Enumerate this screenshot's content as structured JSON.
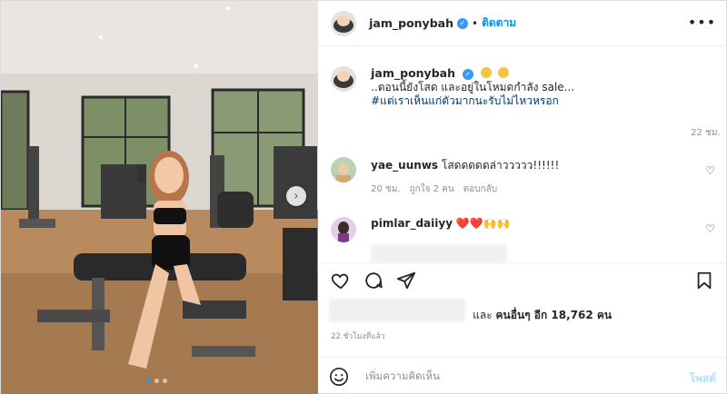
{
  "post": {
    "username": "jam_ponybah",
    "follow_label": "ติดตาม",
    "more_label": "•••"
  },
  "caption": {
    "username": "jam_ponybah",
    "line1": "..ตอนนี้ยังโสด และอยู่ในโหมดกำลัง sale...",
    "hashtag": "#แต่เราเห็นแก่ตัวมากนะรับไม่ไหวหรอก",
    "time": "22 ชม."
  },
  "comments": [
    {
      "username": "yae_uunws",
      "text": "โสดดดดดล่าววววว!!!!!!",
      "time": "20 ชม.",
      "likes": "ถูกใจ 2 คน",
      "reply": "ตอบกลับ"
    },
    {
      "username": "pimlar_daiiyy",
      "text": "❤️❤️🙌🙌"
    }
  ],
  "likes": {
    "connector": "และ",
    "others": "คนอื่นๆ อีก 18,762 คน"
  },
  "post_time": "22 ชั่วโมงที่แล้ว",
  "add_comment": {
    "placeholder": "เพิ่มความคิดเห็น",
    "post_label": "โพสต์"
  },
  "icons": [
    "heart-icon",
    "comment-icon",
    "share-icon",
    "save-icon",
    "smile-icon",
    "verified-icon",
    "next-arrow-icon"
  ],
  "colors": {
    "accent": "#0095f6",
    "verified": "#3897f0",
    "heart": "#ed4956"
  }
}
